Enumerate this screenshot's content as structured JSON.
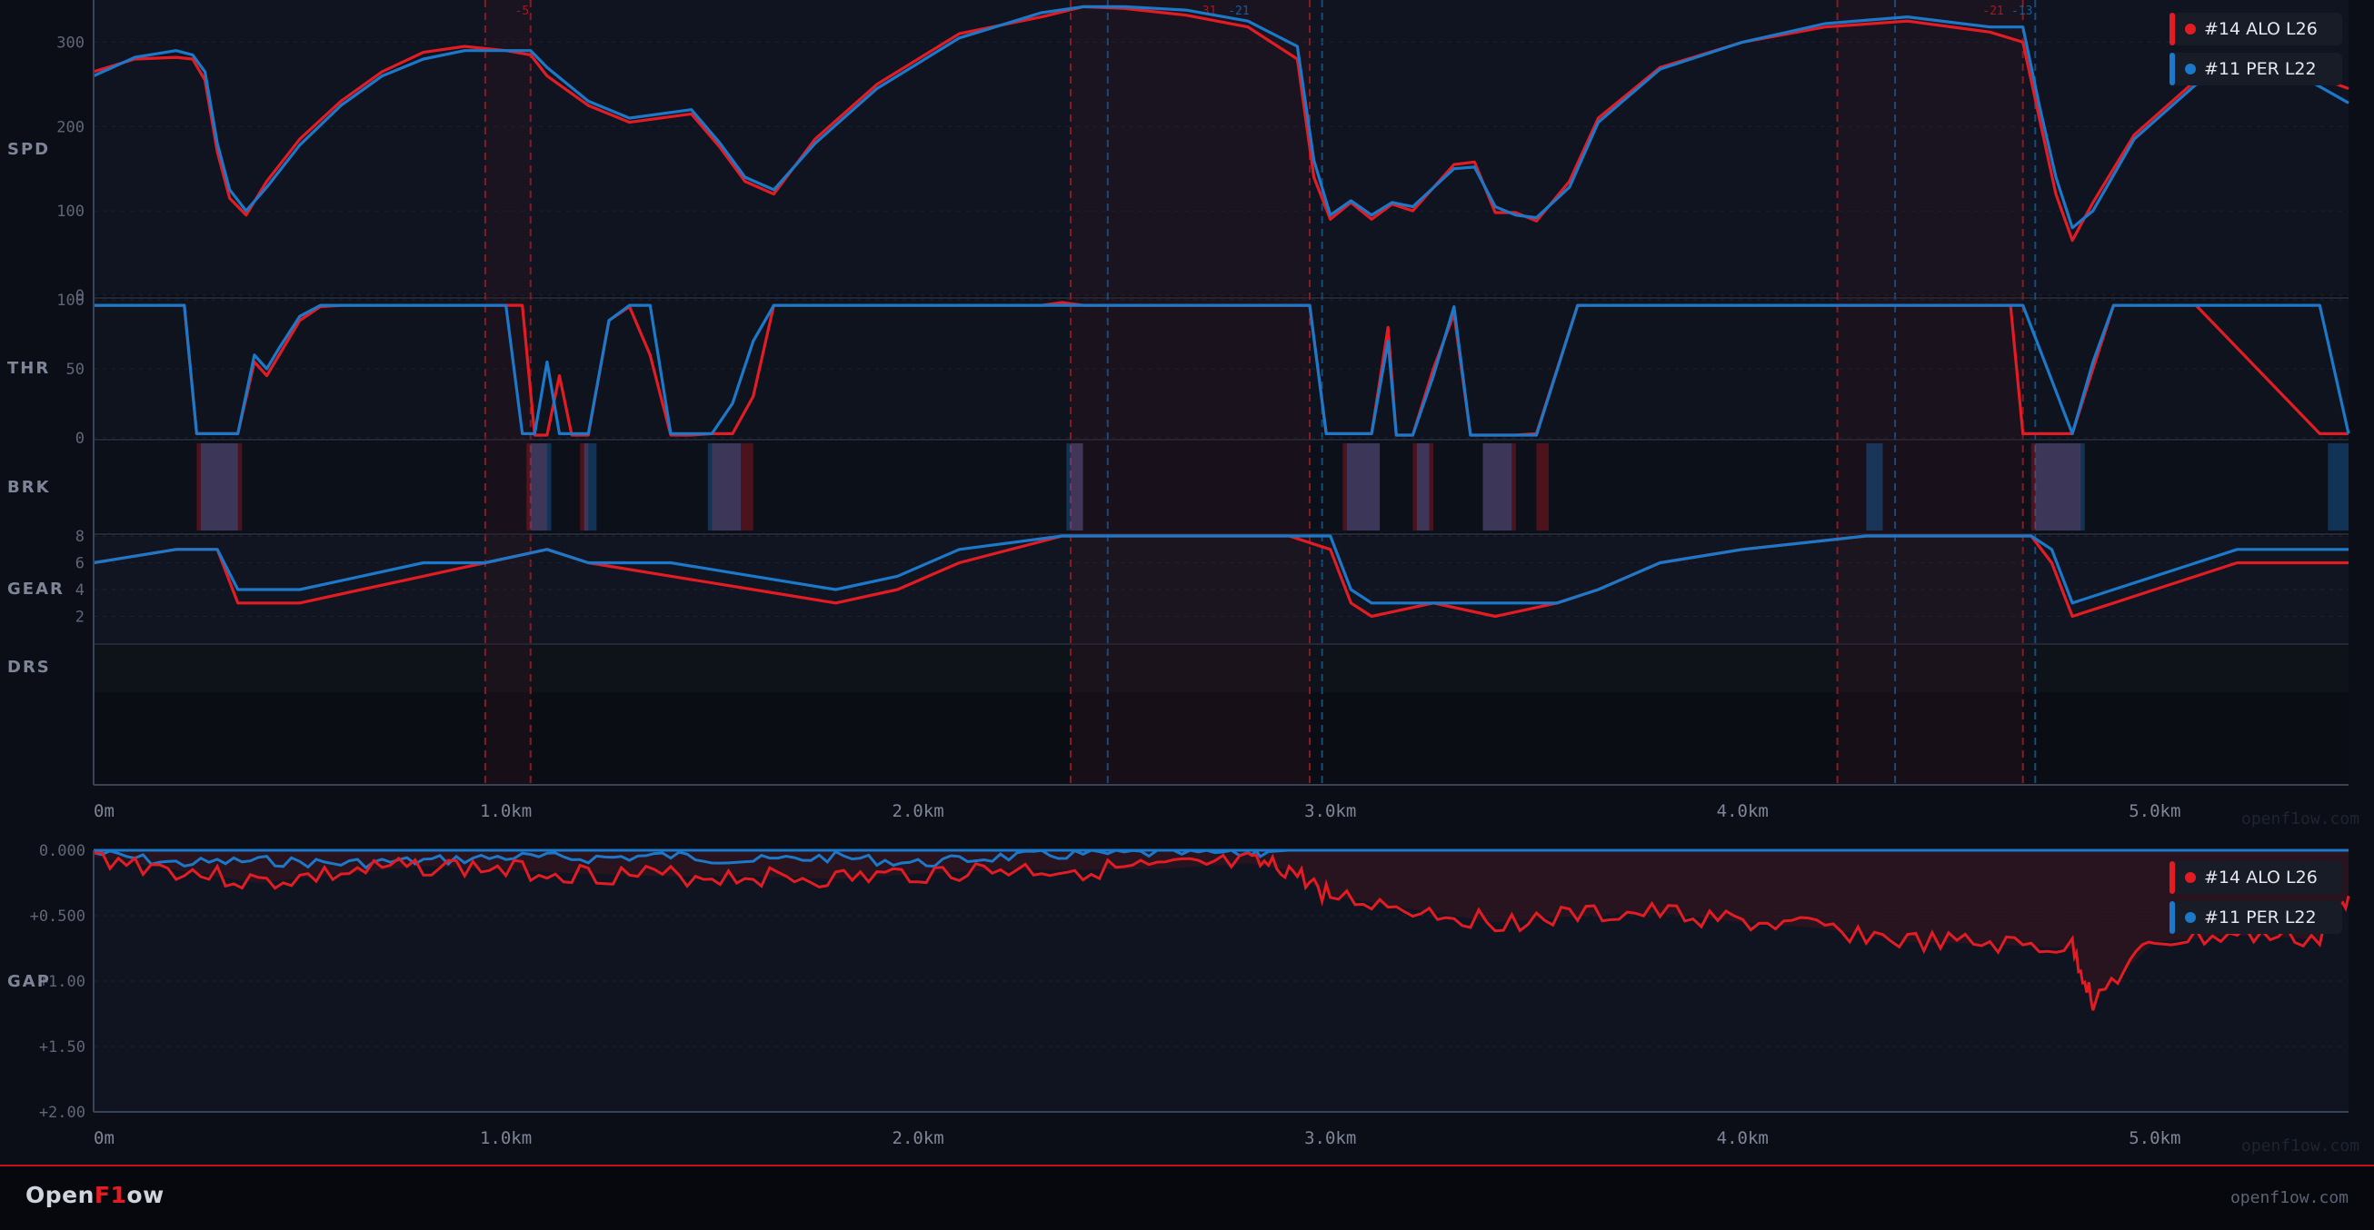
{
  "drivers": [
    {
      "label": "#14 ALO L26",
      "color": "#e31c24"
    },
    {
      "label": "#11 PER L22",
      "color": "#1c78c8"
    }
  ],
  "channels": {
    "spd": "SPD",
    "thr": "THR",
    "brk": "BRK",
    "gear": "GEAR",
    "drs": "DRS",
    "gap": "GAP"
  },
  "footer": {
    "logo_a": "Open",
    "logo_b": "F1",
    "logo_c": "ow",
    "url": "openf1ow.com"
  },
  "watermark": "openf1ow.com",
  "chart_data": [
    {
      "type": "line",
      "title": "",
      "xlabel": "",
      "x_ticks": [
        "0m",
        "1.0km",
        "2.0km",
        "3.0km",
        "4.0km",
        "5.0km"
      ],
      "xlim": [
        0,
        5.47
      ],
      "x_unit": "km",
      "channels": [
        {
          "name": "SPD",
          "ylim": [
            0,
            350
          ],
          "y_ticks": [
            "0",
            "100",
            "200",
            "300"
          ],
          "series": [
            {
              "name": "#14 ALO L26",
              "x": [
                0,
                0.1,
                0.2,
                0.24,
                0.27,
                0.3,
                0.33,
                0.37,
                0.42,
                0.5,
                0.6,
                0.7,
                0.8,
                0.9,
                1.0,
                1.06,
                1.1,
                1.2,
                1.3,
                1.45,
                1.52,
                1.58,
                1.65,
                1.75,
                1.9,
                2.1,
                2.3,
                2.4,
                2.5,
                2.65,
                2.8,
                2.92,
                2.96,
                3.0,
                3.05,
                3.1,
                3.15,
                3.2,
                3.3,
                3.35,
                3.4,
                3.45,
                3.5,
                3.58,
                3.65,
                3.8,
                4.0,
                4.2,
                4.4,
                4.6,
                4.68,
                4.72,
                4.76,
                4.8,
                4.85,
                4.95,
                5.1,
                5.3,
                5.47
              ],
              "values": [
                265,
                280,
                282,
                280,
                255,
                170,
                115,
                95,
                135,
                185,
                230,
                265,
                288,
                295,
                290,
                285,
                260,
                225,
                205,
                215,
                175,
                135,
                120,
                185,
                250,
                310,
                330,
                342,
                340,
                332,
                318,
                280,
                140,
                90,
                110,
                90,
                108,
                100,
                155,
                158,
                98,
                98,
                88,
                135,
                210,
                270,
                300,
                318,
                325,
                312,
                300,
                210,
                120,
                65,
                110,
                190,
                255,
                275,
                245
              ]
            },
            {
              "name": "#11 PER L22",
              "x": [
                0,
                0.1,
                0.2,
                0.24,
                0.27,
                0.3,
                0.33,
                0.37,
                0.42,
                0.5,
                0.6,
                0.7,
                0.8,
                0.9,
                1.0,
                1.06,
                1.1,
                1.2,
                1.3,
                1.45,
                1.52,
                1.58,
                1.65,
                1.75,
                1.9,
                2.1,
                2.3,
                2.4,
                2.5,
                2.65,
                2.8,
                2.92,
                2.96,
                3.0,
                3.05,
                3.1,
                3.15,
                3.2,
                3.3,
                3.35,
                3.4,
                3.45,
                3.5,
                3.58,
                3.65,
                3.8,
                4.0,
                4.2,
                4.4,
                4.6,
                4.68,
                4.72,
                4.76,
                4.8,
                4.85,
                4.95,
                5.1,
                5.3,
                5.47
              ],
              "values": [
                260,
                282,
                290,
                285,
                265,
                180,
                125,
                100,
                128,
                178,
                225,
                260,
                280,
                290,
                290,
                290,
                270,
                230,
                210,
                220,
                180,
                140,
                125,
                180,
                245,
                305,
                335,
                342,
                342,
                338,
                325,
                295,
                160,
                95,
                112,
                95,
                110,
                105,
                150,
                152,
                105,
                95,
                92,
                128,
                205,
                268,
                300,
                322,
                330,
                318,
                318,
                225,
                140,
                80,
                100,
                185,
                250,
                275,
                228
              ]
            }
          ]
        },
        {
          "name": "THR",
          "ylim": [
            0,
            100
          ],
          "y_ticks": [
            "0",
            "50",
            "100"
          ],
          "series": [
            {
              "name": "#14 ALO L26",
              "x": [
                0,
                0.22,
                0.25,
                0.35,
                0.39,
                0.42,
                0.45,
                0.5,
                0.55,
                0.6,
                0.7,
                0.8,
                0.9,
                1.0,
                1.04,
                1.07,
                1.1,
                1.13,
                1.16,
                1.18,
                1.2,
                1.25,
                1.3,
                1.35,
                1.4,
                1.45,
                1.5,
                1.55,
                1.6,
                1.65,
                1.7,
                2.0,
                2.3,
                2.35,
                2.4,
                2.8,
                2.95,
                2.99,
                3.1,
                3.14,
                3.16,
                3.2,
                3.25,
                3.3,
                3.34,
                3.38,
                3.42,
                3.45,
                3.5,
                3.6,
                4.5,
                4.65,
                4.68,
                4.8,
                4.85,
                4.9,
                5.0,
                5.1,
                5.4,
                5.47
              ],
              "values": [
                96,
                96,
                3,
                3,
                55,
                45,
                60,
                85,
                95,
                96,
                96,
                96,
                96,
                96,
                96,
                2,
                2,
                45,
                2,
                2,
                2,
                85,
                95,
                60,
                2,
                2,
                3,
                3,
                30,
                96,
                96,
                96,
                96,
                98,
                96,
                96,
                96,
                3,
                3,
                80,
                2,
                2,
                50,
                90,
                2,
                2,
                2,
                2,
                3,
                96,
                96,
                96,
                3,
                3,
                50,
                96,
                96,
                96,
                3,
                3
              ]
            },
            {
              "name": "#11 PER L22",
              "x": [
                0,
                0.22,
                0.25,
                0.35,
                0.39,
                0.42,
                0.45,
                0.5,
                0.55,
                0.6,
                0.7,
                0.8,
                0.9,
                1.0,
                1.04,
                1.07,
                1.1,
                1.13,
                1.16,
                1.18,
                1.2,
                1.25,
                1.3,
                1.35,
                1.4,
                1.45,
                1.5,
                1.55,
                1.6,
                1.65,
                1.7,
                2.0,
                2.3,
                2.35,
                2.4,
                2.8,
                2.95,
                2.99,
                3.1,
                3.14,
                3.16,
                3.2,
                3.25,
                3.3,
                3.34,
                3.38,
                3.42,
                3.45,
                3.5,
                3.6,
                4.5,
                4.65,
                4.68,
                4.8,
                4.85,
                4.9,
                5.0,
                5.1,
                5.4,
                5.47
              ],
              "values": [
                96,
                96,
                3,
                3,
                60,
                50,
                65,
                88,
                96,
                96,
                96,
                96,
                96,
                96,
                3,
                3,
                55,
                3,
                3,
                3,
                3,
                85,
                96,
                96,
                3,
                3,
                3,
                25,
                70,
                96,
                96,
                96,
                96,
                96,
                96,
                96,
                96,
                3,
                3,
                70,
                2,
                2,
                45,
                95,
                2,
                2,
                2,
                2,
                2,
                96,
                96,
                96,
                96,
                3,
                55,
                96,
                96,
                96,
                96,
                3
              ]
            }
          ]
        },
        {
          "name": "BRK",
          "type": "segments",
          "series": [
            {
              "name": "#14 ALO L26",
              "zones": [
                [
                  0.25,
                  0.36
                ],
                [
                  1.05,
                  1.1
                ],
                [
                  1.18,
                  1.2
                ],
                [
                  1.5,
                  1.6
                ],
                [
                  2.37,
                  2.4
                ],
                [
                  3.03,
                  3.12
                ],
                [
                  3.2,
                  3.25
                ],
                [
                  3.37,
                  3.45
                ],
                [
                  3.5,
                  3.53
                ],
                [
                  4.7,
                  4.82
                ]
              ]
            },
            {
              "name": "#11 PER L22",
              "zones": [
                [
                  0.26,
                  0.35
                ],
                [
                  1.06,
                  1.11
                ],
                [
                  1.19,
                  1.22
                ],
                [
                  1.49,
                  1.57
                ],
                [
                  2.36,
                  2.4
                ],
                [
                  3.04,
                  3.12
                ],
                [
                  3.21,
                  3.24
                ],
                [
                  3.37,
                  3.44
                ],
                [
                  4.3,
                  4.34
                ],
                [
                  4.71,
                  4.83
                ],
                [
                  5.42,
                  5.47
                ]
              ]
            }
          ]
        },
        {
          "name": "GEAR",
          "ylim": [
            0,
            8
          ],
          "y_ticks": [
            "2",
            "4",
            "6",
            "8"
          ],
          "series": [
            {
              "name": "#14 ALO L26",
              "x": [
                0,
                0.2,
                0.3,
                0.35,
                0.5,
                0.65,
                0.8,
                0.95,
                1.1,
                1.2,
                1.4,
                1.6,
                1.8,
                1.95,
                2.1,
                2.35,
                2.9,
                3.0,
                3.05,
                3.1,
                3.25,
                3.4,
                3.55,
                3.65,
                3.8,
                4.0,
                4.3,
                4.6,
                4.7,
                4.75,
                4.8,
                4.9,
                5.0,
                5.2,
                5.47
              ],
              "values": [
                6,
                7,
                7,
                3,
                3,
                4,
                5,
                6,
                7,
                6,
                5,
                4,
                3,
                4,
                6,
                8,
                8,
                7,
                3,
                2,
                3,
                2,
                3,
                4,
                6,
                7,
                8,
                8,
                8,
                6,
                2,
                3,
                4,
                6,
                6
              ]
            },
            {
              "name": "#11 PER L22",
              "x": [
                0,
                0.2,
                0.3,
                0.35,
                0.5,
                0.65,
                0.8,
                0.95,
                1.1,
                1.2,
                1.4,
                1.6,
                1.8,
                1.95,
                2.1,
                2.35,
                2.9,
                3.0,
                3.05,
                3.1,
                3.25,
                3.4,
                3.55,
                3.65,
                3.8,
                4.0,
                4.3,
                4.6,
                4.7,
                4.75,
                4.8,
                4.9,
                5.0,
                5.2,
                5.47
              ],
              "values": [
                6,
                7,
                7,
                4,
                4,
                5,
                6,
                6,
                7,
                6,
                6,
                5,
                4,
                5,
                7,
                8,
                8,
                8,
                4,
                3,
                3,
                3,
                3,
                4,
                6,
                7,
                8,
                8,
                8,
                7,
                3,
                4,
                5,
                7,
                7
              ]
            }
          ]
        },
        {
          "name": "DRS",
          "series": []
        }
      ],
      "corner_zones": [
        [
          0.95,
          1.06
        ],
        [
          2.37,
          2.95
        ],
        [
          4.23,
          4.68
        ]
      ],
      "corner_labels": [
        "-5",
        "-31",
        "-21",
        "-21",
        "-13"
      ]
    },
    {
      "type": "line",
      "title": "",
      "ylabel": "GAP",
      "x_ticks": [
        "0m",
        "1.0km",
        "2.0km",
        "3.0km",
        "4.0km",
        "5.0km"
      ],
      "xlim": [
        0,
        5.47
      ],
      "ylim": [
        0,
        2.0
      ],
      "y_ticks": [
        "0.000",
        "+0.500",
        "+1.00",
        "+1.50",
        "+2.00"
      ],
      "series": [
        {
          "name": "#14 ALO L26",
          "x": [
            0,
            0.2,
            0.4,
            0.6,
            0.8,
            1.0,
            1.2,
            1.4,
            1.6,
            1.8,
            2.0,
            2.2,
            2.4,
            2.6,
            2.8,
            2.9,
            3.0,
            3.2,
            3.4,
            3.6,
            3.8,
            4.0,
            4.2,
            4.4,
            4.6,
            4.8,
            4.85,
            5.0,
            5.2,
            5.4,
            5.47
          ],
          "values": [
            0.05,
            0.15,
            0.25,
            0.18,
            0.12,
            0.15,
            0.18,
            0.2,
            0.2,
            0.22,
            0.18,
            0.15,
            0.15,
            0.14,
            0.1,
            0.15,
            0.35,
            0.45,
            0.55,
            0.5,
            0.48,
            0.55,
            0.6,
            0.7,
            0.72,
            0.75,
            1.15,
            0.7,
            0.65,
            0.68,
            0.35
          ]
        },
        {
          "name": "#11 PER L22",
          "x": [
            0,
            0.2,
            0.4,
            0.6,
            0.8,
            1.0,
            1.2,
            1.4,
            1.6,
            1.8,
            2.0,
            2.2,
            2.4,
            2.6,
            2.8,
            2.9,
            3.0,
            5.47
          ],
          "values": [
            0.02,
            0.1,
            0.08,
            0.1,
            0.08,
            0.05,
            0.06,
            0.04,
            0.08,
            0.05,
            0.1,
            0.05,
            0.03,
            0.02,
            0.02,
            0.0,
            0.0,
            0.0
          ]
        }
      ]
    }
  ]
}
